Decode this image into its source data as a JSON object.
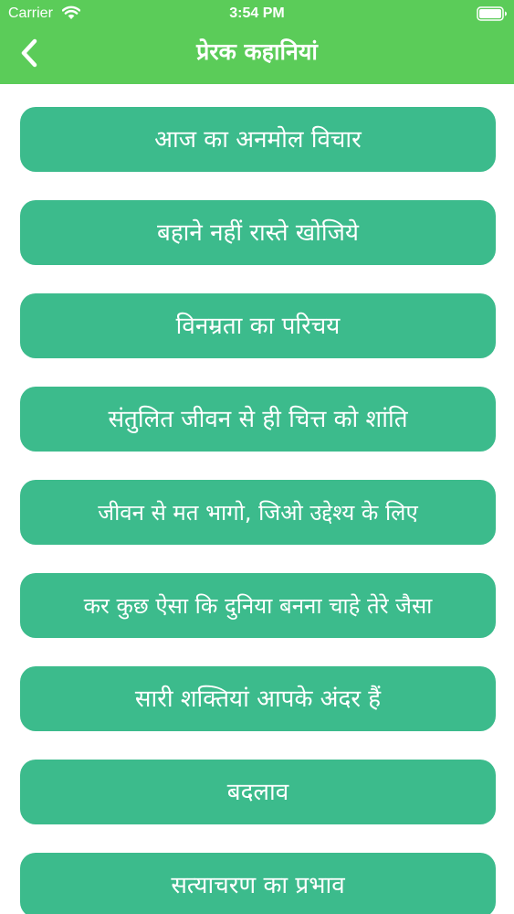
{
  "status_bar": {
    "carrier": "Carrier",
    "time": "3:54 PM"
  },
  "nav": {
    "title": "प्रेरक कहानियां",
    "back_icon": "chevron-left-icon"
  },
  "stories": [
    {
      "label": "आज का अनमोल विचार"
    },
    {
      "label": "बहाने नहीं रास्ते खोजिये"
    },
    {
      "label": "विनम्रता का परिचय"
    },
    {
      "label": "संतुलित जीवन से ही चित्त को शांति"
    },
    {
      "label": "जीवन से मत भागो, जिओ उद्देश्य के लिए"
    },
    {
      "label": "कर कुछ ऐसा कि दुनिया बनना चाहे तेरे जैसा"
    },
    {
      "label": "सारी शक्तियां आपके अंदर हैं"
    },
    {
      "label": "बदलाव"
    },
    {
      "label": "सत्याचरण का प्रभाव"
    }
  ],
  "colors": {
    "header": "#5bcc59",
    "button": "#3cbb8c",
    "text": "#ffffff",
    "background": "#ffffff"
  }
}
